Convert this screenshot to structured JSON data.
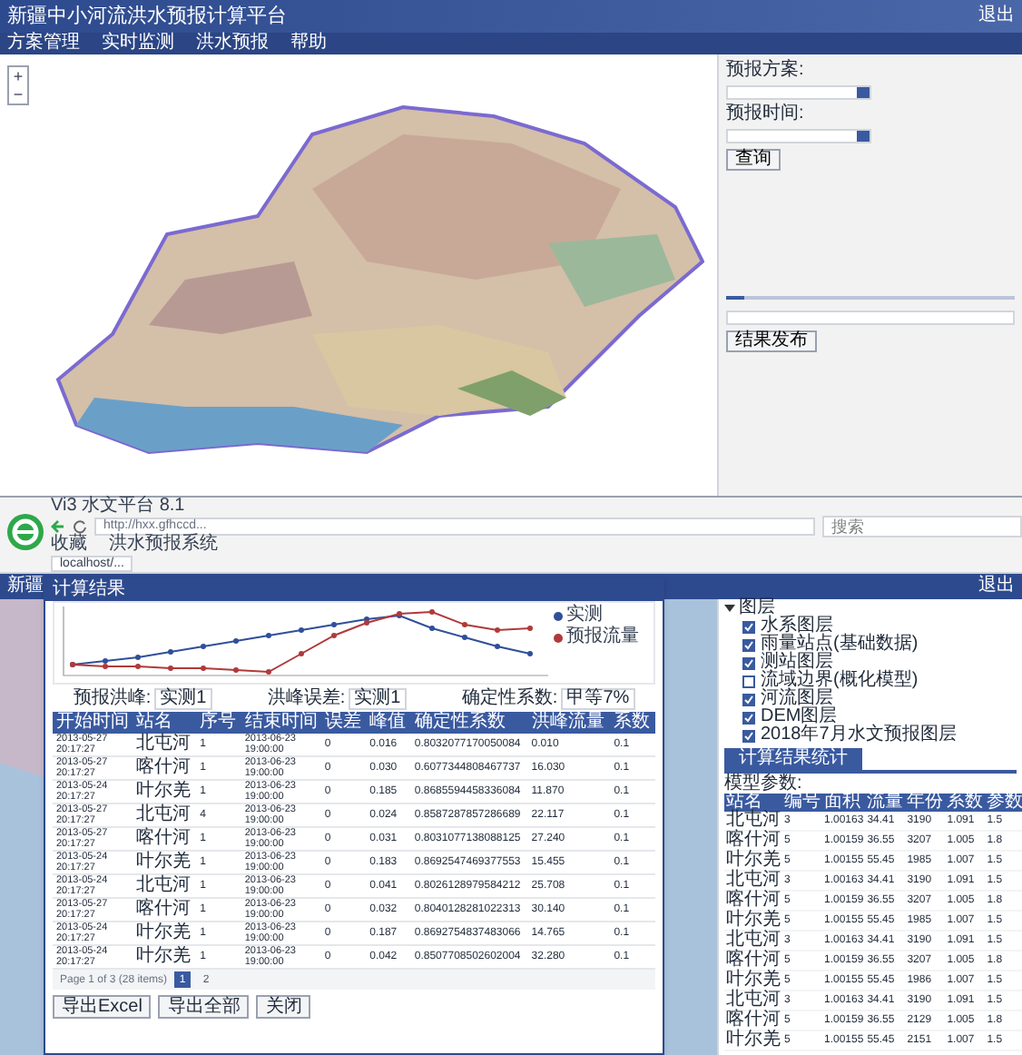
{
  "app_top": {
    "title": "新疆中小河流洪水预报计算平台",
    "nav": [
      "方案管理",
      "实时监测",
      "洪水预报",
      "帮助"
    ],
    "user": "退出"
  },
  "zoom": [
    "+",
    "−"
  ],
  "top_panel": {
    "fields": [
      {
        "label": "预报方案:"
      },
      {
        "label": "预报时间:"
      }
    ],
    "query_button": "查询",
    "slider": {
      "level": 0.06
    },
    "publish_button": "结果发布"
  },
  "browser": {
    "tab_title": "Vi3 水文平台 8.1",
    "url": "http://hxx.gfhccd...",
    "search_placeholder": "搜索",
    "bookmarks": [
      "收藏",
      "洪水预报系统"
    ],
    "page_tab": "localhost/..."
  },
  "app_bottom": {
    "title": "新疆",
    "user": "退出"
  },
  "dialog": {
    "title": "计算结果",
    "legend": [
      {
        "name": "实测",
        "color": "#2f4f9a"
      },
      {
        "name": "预报流量",
        "color": "#b03a3a"
      }
    ],
    "filters": [
      {
        "label": "预报洪峰:",
        "value": "实测1"
      },
      {
        "label": "洪峰误差:",
        "value": "实测1"
      },
      {
        "label": "确定性系数:",
        "value": "甲等7%"
      }
    ],
    "table": {
      "columns": [
        "开始时间",
        "站名",
        "序号",
        "结束时间",
        "误差",
        "峰值",
        "确定性系数",
        "洪峰流量",
        "系数"
      ],
      "rows": [
        [
          "2013-05-27 20:17:27",
          "北屯河",
          "1",
          "2013-06-23 19:00:00",
          "0",
          "0.016",
          "0.8032077170050084",
          "0.010",
          "0.1"
        ],
        [
          "2013-05-27 20:17:27",
          "喀什河",
          "1",
          "2013-06-23 19:00:00",
          "0",
          "0.030",
          "0.6077344808467737",
          "16.030",
          "0.1"
        ],
        [
          "2013-05-24 20:17:27",
          "叶尔羌",
          "1",
          "2013-06-23 19:00:00",
          "0",
          "0.185",
          "0.8685594458336084",
          "11.870",
          "0.1"
        ],
        [
          "2013-05-27 20:17:27",
          "北屯河",
          "4",
          "2013-06-23 19:00:00",
          "0",
          "0.024",
          "0.8587287857286689",
          "22.117",
          "0.1"
        ],
        [
          "2013-05-27 20:17:27",
          "喀什河",
          "1",
          "2013-06-23 19:00:00",
          "0",
          "0.031",
          "0.8031077138088125",
          "27.240",
          "0.1"
        ],
        [
          "2013-05-24 20:17:27",
          "叶尔羌",
          "1",
          "2013-06-23 19:00:00",
          "0",
          "0.183",
          "0.8692547469377553",
          "15.455",
          "0.1"
        ],
        [
          "2013-05-24 20:17:27",
          "北屯河",
          "1",
          "2013-06-23 19:00:00",
          "0",
          "0.041",
          "0.8026128979584212",
          "25.708",
          "0.1"
        ],
        [
          "2013-05-27 20:17:27",
          "喀什河",
          "1",
          "2013-06-23 19:00:00",
          "0",
          "0.032",
          "0.8040128281022313",
          "30.140",
          "0.1"
        ],
        [
          "2013-05-24 20:17:27",
          "叶尔羌",
          "1",
          "2013-06-23 19:00:00",
          "0",
          "0.187",
          "0.8692754837483066",
          "14.765",
          "0.1"
        ],
        [
          "2013-05-24 20:17:27",
          "叶尔羌",
          "1",
          "2013-06-23 19:00:00",
          "0",
          "0.042",
          "0.8507708502602004",
          "32.280",
          "0.1"
        ]
      ]
    },
    "pager": {
      "summary": "Page 1 of 3 (28 items)",
      "pages": [
        {
          "label": "1",
          "selected": true
        },
        {
          "label": "2",
          "selected": false
        }
      ]
    },
    "buttons": [
      "导出Excel",
      "导出全部",
      "关闭"
    ]
  },
  "right_panel": {
    "tree": {
      "label": "图层",
      "expanded": true,
      "children": [
        {
          "label": "水系图层",
          "checked": true
        },
        {
          "label": "雨量站点(基础数据)",
          "checked": true
        },
        {
          "label": "测站图层",
          "checked": true
        },
        {
          "label": "流域边界(概化模型)",
          "checked": false
        },
        {
          "label": "河流图层",
          "checked": true
        },
        {
          "label": "DEM图层",
          "checked": true
        },
        {
          "label": "2018年7月水文预报图层",
          "checked": true
        }
      ]
    },
    "tab": "计算结果统计",
    "table_title": "模型参数:",
    "table": {
      "columns": [
        "站名",
        "编号",
        "面积",
        "流量",
        "年份",
        "系数",
        "参数"
      ],
      "rows": [
        [
          "北屯河",
          "3",
          "1.00163",
          "34.41",
          "3190",
          "1.091",
          "1.5"
        ],
        [
          "喀什河",
          "5",
          "1.00159",
          "36.55",
          "3207",
          "1.005",
          "1.8"
        ],
        [
          "叶尔羌",
          "5",
          "1.00155",
          "55.45",
          "1985",
          "1.007",
          "1.5"
        ],
        [
          "北屯河",
          "3",
          "1.00163",
          "34.41",
          "3190",
          "1.091",
          "1.5"
        ],
        [
          "喀什河",
          "5",
          "1.00159",
          "36.55",
          "3207",
          "1.005",
          "1.8"
        ],
        [
          "叶尔羌",
          "5",
          "1.00155",
          "55.45",
          "1985",
          "1.007",
          "1.5"
        ],
        [
          "北屯河",
          "3",
          "1.00163",
          "34.41",
          "3190",
          "1.091",
          "1.5"
        ],
        [
          "喀什河",
          "5",
          "1.00159",
          "36.55",
          "3207",
          "1.005",
          "1.8"
        ],
        [
          "叶尔羌",
          "5",
          "1.00155",
          "55.45",
          "1986",
          "1.007",
          "1.5"
        ],
        [
          "北屯河",
          "3",
          "1.00163",
          "34.41",
          "3190",
          "1.091",
          "1.5"
        ],
        [
          "喀什河",
          "5",
          "1.00159",
          "36.55",
          "2129",
          "1.005",
          "1.8"
        ],
        [
          "叶尔羌",
          "5",
          "1.00155",
          "55.45",
          "2151",
          "1.007",
          "1.5"
        ]
      ]
    }
  }
}
